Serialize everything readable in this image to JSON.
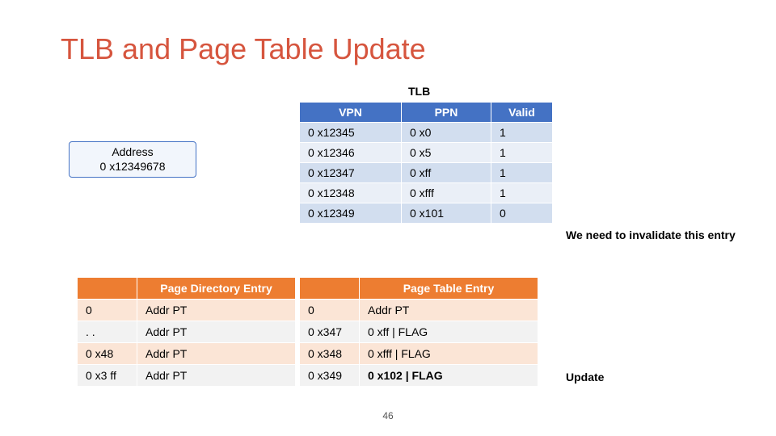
{
  "title": "TLB and Page Table Update",
  "tlb_label": "TLB",
  "address_box": {
    "line1": "Address",
    "line2": "0 x12349678"
  },
  "tlb": {
    "headers": [
      "VPN",
      "PPN",
      "Valid"
    ],
    "rows": [
      {
        "vpn": "0 x12345",
        "ppn": "0 x0",
        "valid": "1"
      },
      {
        "vpn": "0 x12346",
        "ppn": "0 x5",
        "valid": "1"
      },
      {
        "vpn": "0 x12347",
        "ppn": "0 xff",
        "valid": "1"
      },
      {
        "vpn": "0 x12348",
        "ppn": "0 xfff",
        "valid": "1"
      },
      {
        "vpn": "0 x12349",
        "ppn": "0 x101",
        "valid": "0"
      }
    ]
  },
  "annotations": {
    "invalidate": "We need to invalidate this entry",
    "update": "Update"
  },
  "page_directory": {
    "header": "Page Directory Entry",
    "rows": [
      {
        "idx": "0",
        "val": "Addr PT"
      },
      {
        "idx": ". .",
        "val": "Addr PT"
      },
      {
        "idx": "0 x48",
        "val": "Addr PT"
      },
      {
        "idx": "0 x3 ff",
        "val": "Addr PT"
      }
    ]
  },
  "page_table": {
    "header": "Page Table Entry",
    "rows": [
      {
        "idx": "0",
        "val": "Addr PT"
      },
      {
        "idx": "0 x347",
        "val": "0 xff | FLAG"
      },
      {
        "idx": "0 x348",
        "val": "0 xfff | FLAG"
      },
      {
        "idx": "0 x349",
        "val": "0 x102 | FLAG"
      }
    ]
  },
  "page_number": "46"
}
